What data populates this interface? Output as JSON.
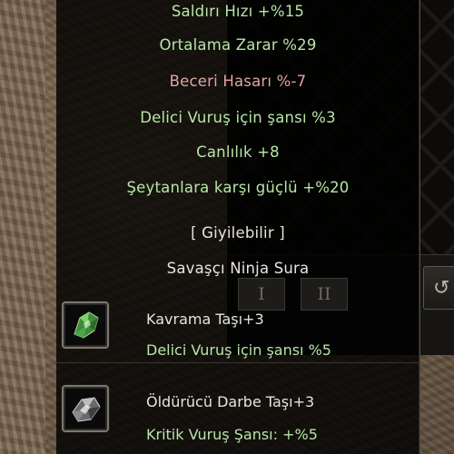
{
  "tooltip": {
    "lines": [
      {
        "text": "Saldırı Hızı +%15",
        "color": "green"
      },
      {
        "text": "Ortalama Zarar %29",
        "color": "green"
      },
      {
        "text": "Beceri Hasarı %-7",
        "color": "red"
      },
      {
        "text": "Delici Vuruş için şansı %3",
        "color": "green"
      },
      {
        "text": "Canlılık +8",
        "color": "green"
      },
      {
        "text": "Şeytanlara karşı güçlü +%20",
        "color": "green"
      }
    ],
    "wearable": "[ Giyilebilir ]",
    "classes": "Savaşçı Ninja Sura",
    "job_buttons": [
      "I",
      "II"
    ]
  },
  "stones": [
    {
      "name": "Kavrama Taşı+3",
      "bonus": "Delici Vuruş için şansı %5",
      "icon": "green-gem-icon"
    },
    {
      "name": "Öldürücü Darbe Taşı+3",
      "bonus": "Kritik Vuruş Şansı: +%5",
      "icon": "silver-gem-icon"
    }
  ],
  "side_button": {
    "icon": "refresh-icon",
    "glyph": "↺"
  },
  "colors": {
    "green": "#b6e6a6",
    "red": "#e0a5a0",
    "white": "#e8e4da"
  }
}
